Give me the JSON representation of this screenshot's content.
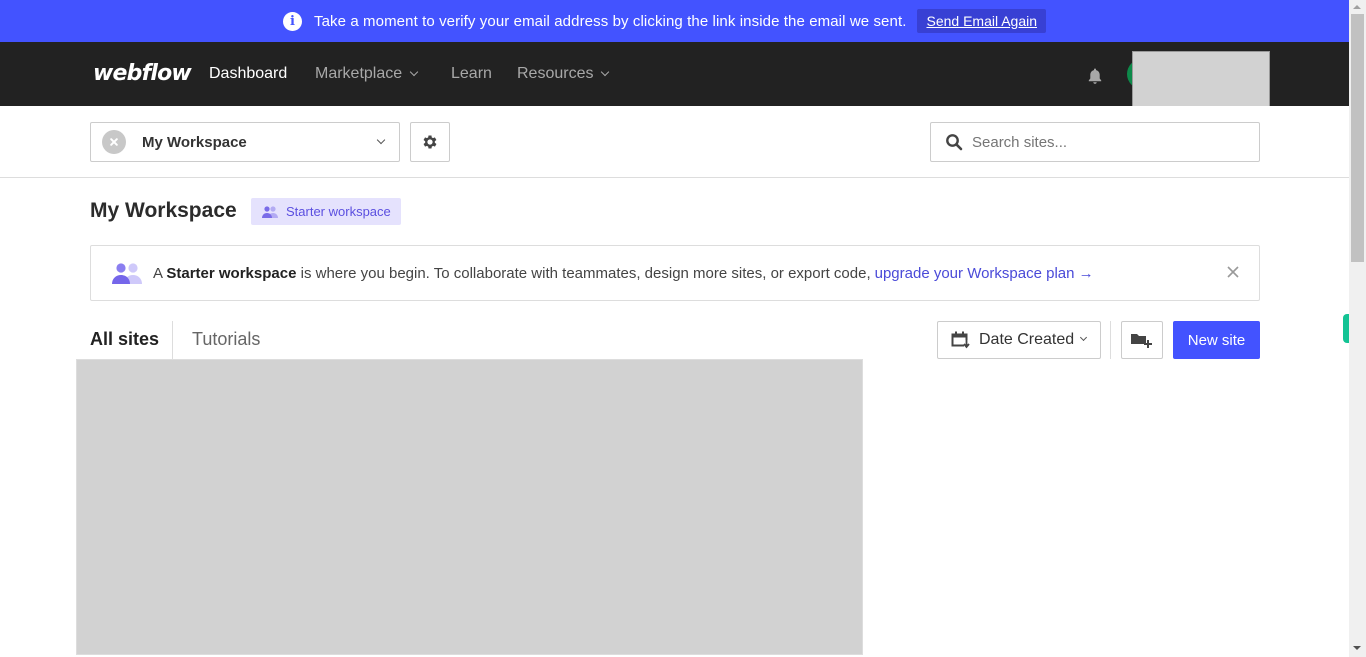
{
  "banner": {
    "message": "Take a moment to verify your email address by clicking the link inside the email we sent.",
    "button_label": "Send Email Again",
    "color": "#4353ff"
  },
  "nav": {
    "logo": "webflow",
    "items": [
      {
        "label": "Dashboard",
        "active": true,
        "has_dropdown": false
      },
      {
        "label": "Marketplace",
        "active": false,
        "has_dropdown": true
      },
      {
        "label": "Learn",
        "active": false,
        "has_dropdown": false
      },
      {
        "label": "Resources",
        "active": false,
        "has_dropdown": true
      }
    ],
    "icons": [
      "bell-icon",
      "avatar"
    ]
  },
  "toolbar": {
    "workspace_selector": "My Workspace",
    "settings_icon": "gear-icon",
    "search_placeholder": "Search sites..."
  },
  "workspace": {
    "title": "My Workspace",
    "badge": "Starter workspace"
  },
  "notice": {
    "prefix": "A ",
    "bold": "Starter workspace",
    "text": " is where you begin. To collaborate with teammates, design more sites, or export code,",
    "link": "upgrade your Workspace plan →"
  },
  "tabs": [
    {
      "label": "All sites",
      "active": true
    },
    {
      "label": "Tutorials",
      "active": false
    }
  ],
  "actions": {
    "sort_label": "Date Created",
    "new_folder_icon": "folder-plus-icon",
    "new_site_label": "New site"
  },
  "colors": {
    "accent": "#4353ff",
    "nav_bg": "#222222",
    "badge_bg": "#e5e2fd",
    "badge_text": "#5b4fe0"
  }
}
